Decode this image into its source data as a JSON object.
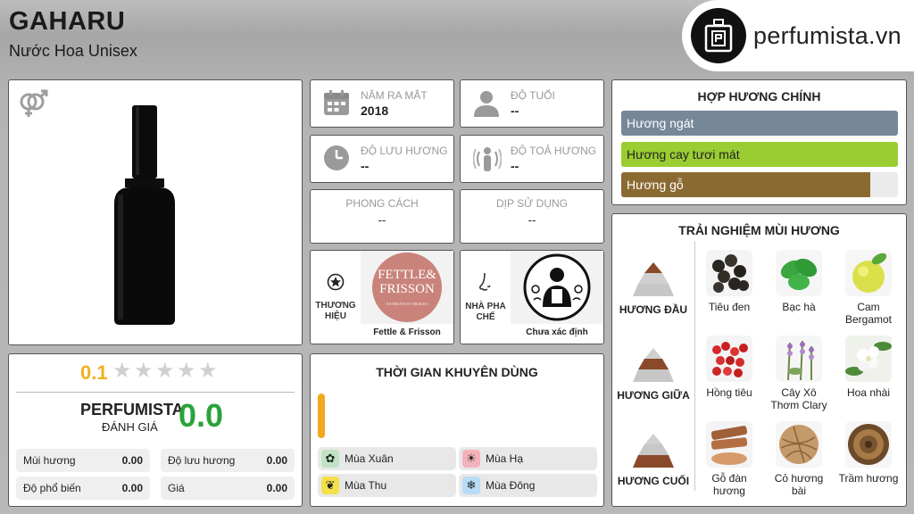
{
  "header": {
    "title": "GAHARU",
    "subtitle": "Nước Hoa Unisex"
  },
  "logo": {
    "text": "perfumista.vn",
    "icon": "perfume-bottle-icon"
  },
  "product": {
    "gender_icon": "unisex-gender-icon"
  },
  "info": {
    "release_year": {
      "label": "NĂM RA MẮT",
      "value": "2018",
      "icon": "calendar-icon"
    },
    "age": {
      "label": "ĐỘ TUỔI",
      "value": "--",
      "icon": "person-icon"
    },
    "longevity": {
      "label": "ĐỘ LƯU HƯƠNG",
      "value": "--",
      "icon": "clock-icon"
    },
    "sillage": {
      "label": "ĐỘ TOẢ HƯƠNG",
      "value": "--",
      "icon": "sillage-icon"
    },
    "style": {
      "label": "PHONG CÁCH",
      "value": "--"
    },
    "occasion": {
      "label": "DỊP SỬ DỤNG",
      "value": "--"
    }
  },
  "brand": {
    "label_line1": "THƯƠNG",
    "label_line2": "HIỆU",
    "logo_line1": "FETTLE&",
    "logo_line2": "FRISSON",
    "logo_tag": "EXTRAITS ET HUILES",
    "name": "Fettle & Frisson",
    "icon": "star-badge-icon"
  },
  "perfumer": {
    "label_line1": "NHÀ PHA",
    "label_line2": "CHẾ",
    "name": "Chưa xác định",
    "icon": "nose-icon"
  },
  "rating": {
    "score": "0.1",
    "stars_filled": 0,
    "stars_total": 5,
    "perfumista_label": "PERFUMISTA",
    "perfumista_sub": "ĐÁNH GIÁ",
    "perfumista_score": "0.0",
    "metrics": [
      {
        "label": "Mùi hương",
        "value": "0.00"
      },
      {
        "label": "Độ lưu hương",
        "value": "0.00"
      },
      {
        "label": "Độ phổ biến",
        "value": "0.00"
      },
      {
        "label": "Giá",
        "value": "0.00"
      }
    ]
  },
  "seasons": {
    "title": "THỜI GIAN KHUYÊN DÙNG",
    "bar_color": "#f2a81d",
    "items": [
      {
        "label": "Mùa Xuân",
        "icon": "spring-flower-icon",
        "color": "#bfe3c3"
      },
      {
        "label": "Mùa Hạ",
        "icon": "sun-icon",
        "color": "#f4b3bc"
      },
      {
        "label": "Mùa Thu",
        "icon": "leaf-icon",
        "color": "#f4e04a"
      },
      {
        "label": "Mùa Đông",
        "icon": "snowflake-icon",
        "color": "#b8dcf5"
      }
    ]
  },
  "accords": {
    "title": "HỢP HƯƠNG CHÍNH",
    "items": [
      {
        "label": "Hương ngát",
        "color": "#76879a",
        "fill": 1.0
      },
      {
        "label": "Hương cay tươi mát",
        "color": "#9acd32",
        "fill": 1.0
      },
      {
        "label": "Hương gỗ",
        "color": "#8b6a32",
        "fill": 0.9
      }
    ]
  },
  "notes": {
    "title": "TRẢI NGHIỆM MÙI HƯƠNG",
    "top": {
      "label": "HƯƠNG ĐẦU",
      "items": [
        "Tiêu đen",
        "Bạc hà",
        "Cam Bergamot"
      ]
    },
    "middle": {
      "label": "HƯƠNG GIỮA",
      "items": [
        "Hồng tiêu",
        "Cây Xô Thơm Clary",
        "Hoa nhài"
      ]
    },
    "base": {
      "label": "HƯƠNG CUỐI",
      "items": [
        "Gỗ đàn hương",
        "Cỏ hương bài",
        "Trầm hương"
      ]
    }
  }
}
